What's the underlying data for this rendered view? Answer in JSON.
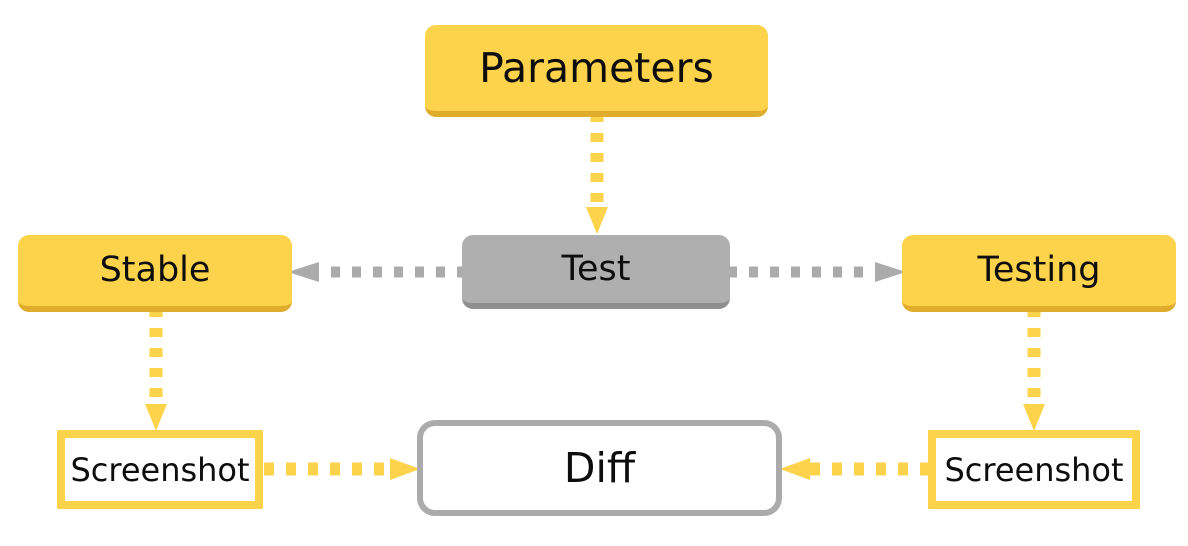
{
  "diagram": {
    "title": "Test pipeline diagram",
    "background": "#ffffff",
    "colors": {
      "yellow_fill": "#FCD34A",
      "yellow_shadow": "#E0AC2B",
      "gray_fill": "#AFAFAF",
      "gray_shadow": "#8F8F8F",
      "gray_stroke": "#ABABAB",
      "text": "#0D0D0D",
      "white": "#FFFFFF"
    },
    "nodes": [
      {
        "id": "parameters",
        "label": "Parameters",
        "style": "filled-yellow"
      },
      {
        "id": "test",
        "label": "Test",
        "style": "filled-gray"
      },
      {
        "id": "stable",
        "label": "Stable",
        "style": "filled-yellow"
      },
      {
        "id": "testing",
        "label": "Testing",
        "style": "filled-yellow"
      },
      {
        "id": "screenshot-left",
        "label": "Screenshot",
        "style": "outline-yellow"
      },
      {
        "id": "screenshot-right",
        "label": "Screenshot",
        "style": "outline-yellow"
      },
      {
        "id": "diff",
        "label": "Diff",
        "style": "outline-gray"
      }
    ],
    "edges": [
      {
        "id": "parameters-to-test",
        "from": "parameters",
        "to": "test",
        "color": "#FCD34A",
        "style": "dotted",
        "direction": "down"
      },
      {
        "id": "test-to-stable",
        "from": "test",
        "to": "stable",
        "color": "#ABABAB",
        "style": "dotted",
        "direction": "left"
      },
      {
        "id": "test-to-testing",
        "from": "test",
        "to": "testing",
        "color": "#ABABAB",
        "style": "dotted",
        "direction": "right"
      },
      {
        "id": "stable-to-screenshot",
        "from": "stable",
        "to": "screenshot-left",
        "color": "#FCD34A",
        "style": "dotted",
        "direction": "down"
      },
      {
        "id": "testing-to-screenshot",
        "from": "testing",
        "to": "screenshot-right",
        "color": "#FCD34A",
        "style": "dotted",
        "direction": "down"
      },
      {
        "id": "screenshot-left-to-diff",
        "from": "screenshot-left",
        "to": "diff",
        "color": "#FCD34A",
        "style": "dotted",
        "direction": "right"
      },
      {
        "id": "screenshot-right-to-diff",
        "from": "screenshot-right",
        "to": "diff",
        "color": "#FCD34A",
        "style": "dotted",
        "direction": "left"
      }
    ]
  }
}
